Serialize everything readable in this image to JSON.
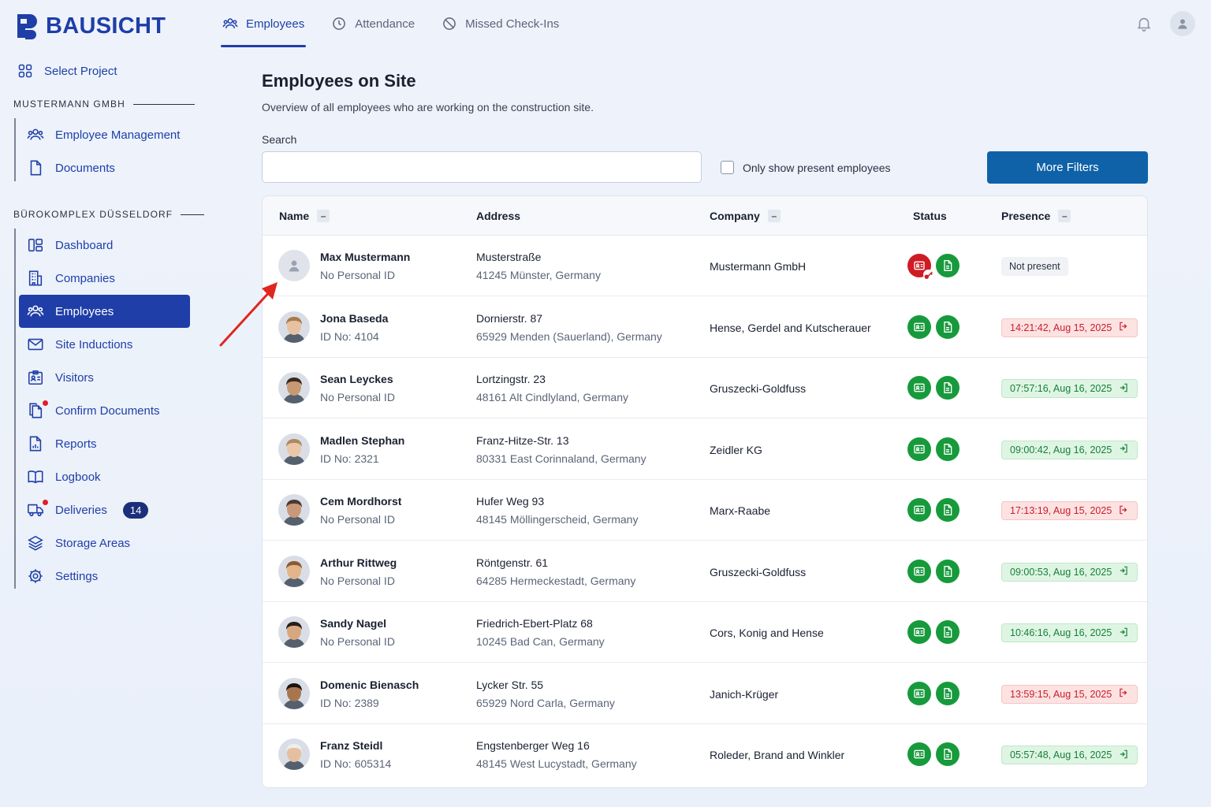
{
  "app": {
    "brand": "BAUSICHT"
  },
  "topnav": [
    {
      "label": "Employees",
      "icon": "users-icon",
      "active": true
    },
    {
      "label": "Attendance",
      "icon": "clock-icon",
      "active": false
    },
    {
      "label": "Missed Check-Ins",
      "icon": "ban-icon",
      "active": false
    }
  ],
  "sidebar": {
    "select_project": "Select Project",
    "group1": {
      "label": "MUSTERMANN GMBH",
      "items": [
        {
          "label": "Employee Management",
          "icon": "users-icon"
        },
        {
          "label": "Documents",
          "icon": "document-icon"
        }
      ]
    },
    "group2": {
      "label": "BÜROKOMPLEX DÜSSELDORF",
      "items": [
        {
          "label": "Dashboard",
          "icon": "dashboard-icon"
        },
        {
          "label": "Companies",
          "icon": "building-icon"
        },
        {
          "label": "Employees",
          "icon": "users-icon",
          "active": true
        },
        {
          "label": "Site Inductions",
          "icon": "mail-icon"
        },
        {
          "label": "Visitors",
          "icon": "id-card-icon"
        },
        {
          "label": "Confirm Documents",
          "icon": "documents-icon",
          "dot": true
        },
        {
          "label": "Reports",
          "icon": "report-icon"
        },
        {
          "label": "Logbook",
          "icon": "book-icon"
        },
        {
          "label": "Deliveries",
          "icon": "truck-icon",
          "dot": true,
          "badge": "14"
        },
        {
          "label": "Storage Areas",
          "icon": "layers-icon"
        },
        {
          "label": "Settings",
          "icon": "gear-icon"
        }
      ]
    }
  },
  "main": {
    "title": "Employees on Site",
    "subtitle": "Overview of all employees who are working on the construction site.",
    "search_label": "Search",
    "search_value": "",
    "checkbox_label": "Only show present employees",
    "checkbox_checked": false,
    "more_filters": "More Filters"
  },
  "table": {
    "columns": {
      "name": "Name",
      "address": "Address",
      "company": "Company",
      "status": "Status",
      "presence": "Presence"
    },
    "rows": [
      {
        "name": "Max Mustermann",
        "id": "No Personal  ID",
        "addr1": "Musterstraße",
        "addr2": "41245 Münster, Germany",
        "company": "Mustermann GmbH",
        "badge_status": "red",
        "presence": "Not present",
        "presence_state": "none",
        "avatar": "placeholder",
        "skin": "#e0e4ea",
        "hair": "#b5bcc8"
      },
      {
        "name": "Jona Baseda",
        "id": "ID No: 4104",
        "addr1": "Dornierstr. 87",
        "addr2": "65929 Menden (Sauerland), Germany",
        "company": "Hense, Gerdel and Kutscherauer",
        "badge_status": "green",
        "presence": "14:21:42, Aug 15, 2025",
        "presence_state": "out",
        "avatar": "photo",
        "skin": "#e7c2a2",
        "hair": "#a77a4e"
      },
      {
        "name": "Sean Leyckes",
        "id": "No Personal  ID",
        "addr1": "Lortzingstr. 23",
        "addr2": "48161 Alt Cindlyland, Germany",
        "company": "Gruszecki-Goldfuss",
        "badge_status": "green",
        "presence": "07:57:16, Aug 16, 2025",
        "presence_state": "in",
        "avatar": "photo",
        "skin": "#c89a74",
        "hair": "#3a2a20"
      },
      {
        "name": "Madlen Stephan",
        "id": "ID No: 2321",
        "addr1": "Franz-Hitze-Str. 13",
        "addr2": "80331 East Corinnaland, Germany",
        "company": "Zeidler KG",
        "badge_status": "green",
        "presence": "09:00:42, Aug 16, 2025",
        "presence_state": "in",
        "avatar": "photo",
        "skin": "#eac7a8",
        "hair": "#b08760"
      },
      {
        "name": "Cem Mordhorst",
        "id": "No Personal  ID",
        "addr1": "Hufer Weg 93",
        "addr2": "48145 Möllingerscheid, Germany",
        "company": "Marx-Raabe",
        "badge_status": "green",
        "presence": "17:13:19, Aug 15, 2025",
        "presence_state": "out",
        "avatar": "photo",
        "skin": "#c99878",
        "hair": "#4a3a30"
      },
      {
        "name": "Arthur Rittweg",
        "id": "No Personal  ID",
        "addr1": "Röntgenstr. 61",
        "addr2": "64285 Hermeckestadt, Germany",
        "company": "Gruszecki-Goldfuss",
        "badge_status": "green",
        "presence": "09:00:53, Aug 16, 2025",
        "presence_state": "in",
        "avatar": "photo",
        "skin": "#e3b48a",
        "hair": "#8a5a30"
      },
      {
        "name": "Sandy Nagel",
        "id": "No Personal  ID",
        "addr1": "Friedrich-Ebert-Platz 68",
        "addr2": "10245 Bad Can, Germany",
        "company": "Cors, Konig and Hense",
        "badge_status": "green",
        "presence": "10:46:16, Aug 16, 2025",
        "presence_state": "in",
        "avatar": "photo",
        "skin": "#d7a880",
        "hair": "#2a1e16"
      },
      {
        "name": "Domenic Bienasch",
        "id": "ID No: 2389",
        "addr1": "Lycker Str. 55",
        "addr2": "65929 Nord Carla, Germany",
        "company": "Janich-Krüger",
        "badge_status": "green",
        "presence": "13:59:15, Aug 15, 2025",
        "presence_state": "out",
        "avatar": "photo",
        "skin": "#a8764e",
        "hair": "#1a1410"
      },
      {
        "name": "Franz Steidl",
        "id": "ID No: 605314",
        "addr1": "Engstenberger Weg 16",
        "addr2": "48145 West Lucystadt, Germany",
        "company": "Roleder, Brand and Winkler",
        "badge_status": "green",
        "presence": "05:57:48, Aug 16, 2025",
        "presence_state": "in",
        "avatar": "photo",
        "skin": "#e5c0a0",
        "hair": "#eeeeee"
      }
    ]
  },
  "colors": {
    "primary": "#1f3ea8",
    "button": "#0f62a8",
    "status_green": "#179a3c",
    "status_red": "#cf1b24"
  }
}
